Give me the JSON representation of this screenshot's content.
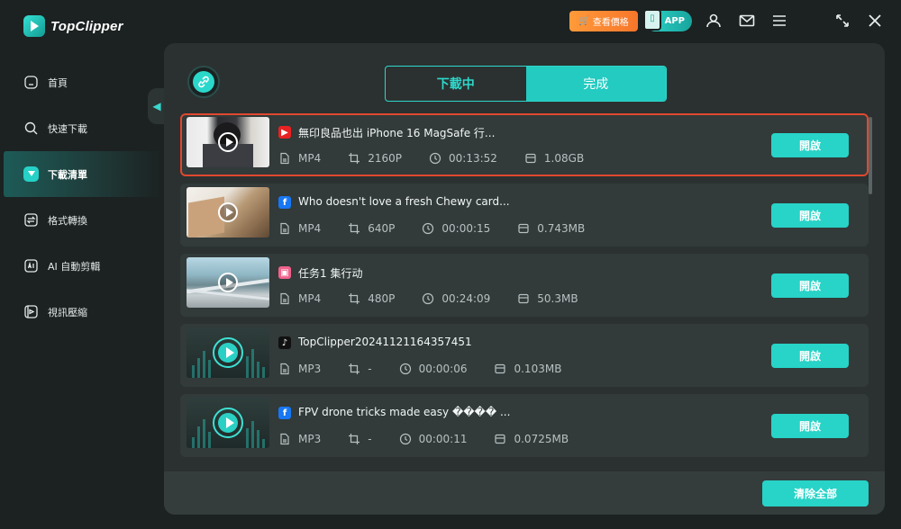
{
  "app": {
    "name": "TopClipper"
  },
  "topbar": {
    "price_label": "查看價格",
    "app_label": "APP",
    "icons": [
      "user-icon",
      "mail-icon",
      "menu-icon",
      "minimize-icon",
      "maximize-icon",
      "close-icon"
    ]
  },
  "sidebar": {
    "items": [
      {
        "label": "首頁",
        "icon": "home-icon",
        "active": false
      },
      {
        "label": "快速下載",
        "icon": "search-icon",
        "active": false
      },
      {
        "label": "下載清單",
        "icon": "download-icon",
        "active": true
      },
      {
        "label": "格式轉換",
        "icon": "convert-icon",
        "active": false
      },
      {
        "label": "AI 自動剪輯",
        "icon": "ai-edit-icon",
        "active": false
      },
      {
        "label": "視訊壓縮",
        "icon": "compress-icon",
        "active": false
      }
    ]
  },
  "tabs": {
    "downloading": "下載中",
    "completed": "完成",
    "selected": "completed"
  },
  "downloads": [
    {
      "source": "youtube",
      "title": "無印良品也出 iPhone 16 MagSafe 行...",
      "format": "MP4",
      "resolution": "2160P",
      "duration": "00:13:52",
      "size": "1.08GB",
      "open_label": "開啟",
      "highlighted": true
    },
    {
      "source": "facebook",
      "title": "Who doesn't love a fresh Chewy card...",
      "format": "MP4",
      "resolution": "640P",
      "duration": "00:00:15",
      "size": "0.743MB",
      "open_label": "開啟"
    },
    {
      "source": "bilibili",
      "title": "任务1 集行动",
      "format": "MP4",
      "resolution": "480P",
      "duration": "00:24:09",
      "size": "50.3MB",
      "open_label": "開啟"
    },
    {
      "source": "tiktok",
      "title": "TopClipper20241121164357451",
      "format": "MP3",
      "resolution": "-",
      "duration": "00:00:06",
      "size": "0.103MB",
      "open_label": "開啟"
    },
    {
      "source": "facebook",
      "title": "FPV drone tricks made easy ���� ...",
      "format": "MP3",
      "resolution": "-",
      "duration": "00:00:11",
      "size": "0.0725MB",
      "open_label": "開啟"
    }
  ],
  "footer": {
    "clear_all_label": "清除全部"
  },
  "colors": {
    "accent": "#28d3c7",
    "highlight_border": "#e0482f",
    "price_orange": "#f7762a"
  }
}
